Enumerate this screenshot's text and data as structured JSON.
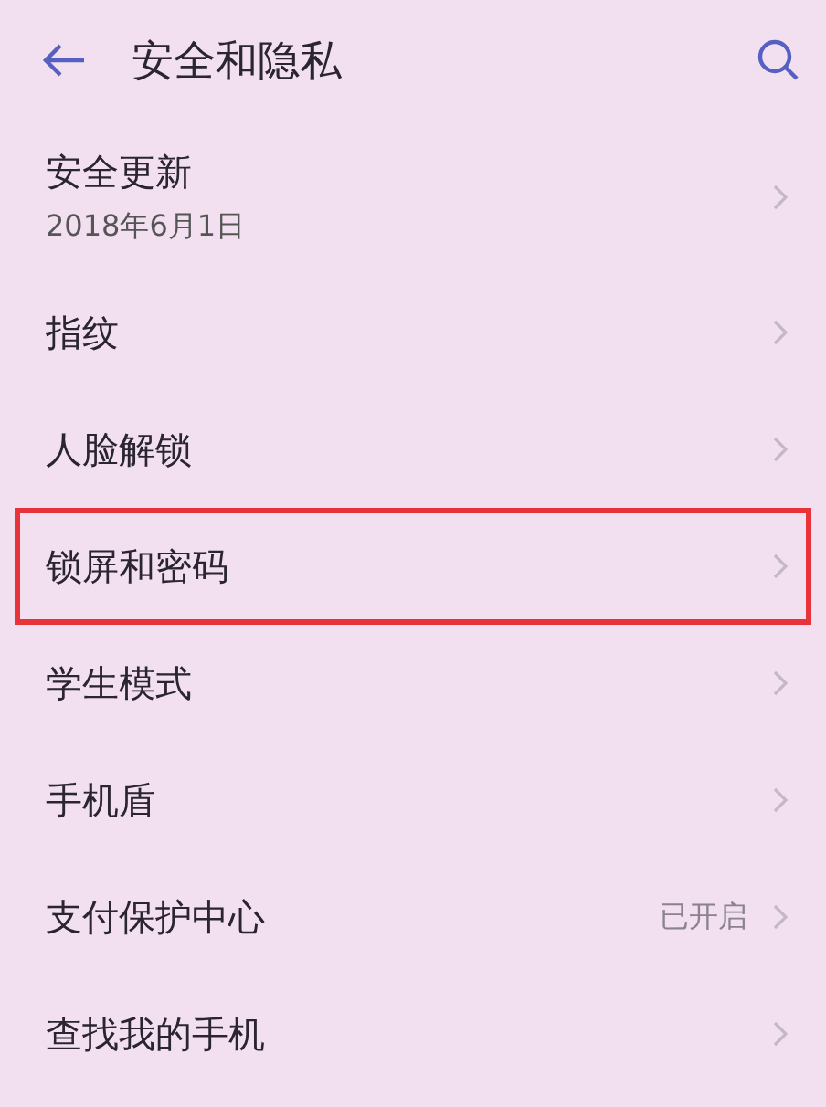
{
  "header": {
    "title": "安全和隐私"
  },
  "items": [
    {
      "label": "安全更新",
      "subtitle": "2018年6月1日",
      "highlighted": false
    },
    {
      "label": "指纹",
      "highlighted": false
    },
    {
      "label": "人脸解锁",
      "highlighted": false
    },
    {
      "label": "锁屏和密码",
      "highlighted": true
    },
    {
      "label": "学生模式",
      "highlighted": false
    },
    {
      "label": "手机盾",
      "highlighted": false
    },
    {
      "label": "支付保护中心",
      "value": "已开启",
      "highlighted": false
    },
    {
      "label": "查找我的手机",
      "highlighted": false
    }
  ]
}
